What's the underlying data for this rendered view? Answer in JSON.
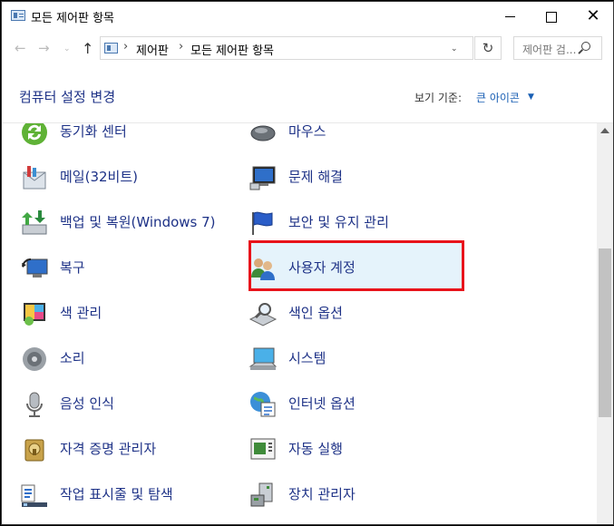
{
  "window": {
    "title": "모든 제어판 항목"
  },
  "titlebar": {
    "min": "",
    "max": "",
    "close": "✕"
  },
  "nav": {
    "back": "←",
    "forward": "→",
    "dropdown": "⌄",
    "up": "↑"
  },
  "address": {
    "sep1": "›",
    "crumb1": "제어판",
    "sep2": "›",
    "crumb2": "모든 제어판 항목",
    "dropdown": "⌄",
    "refresh": "↻"
  },
  "search": {
    "placeholder": "제어판 검..."
  },
  "header": {
    "title": "컴퓨터 설정 변경",
    "view_label": "보기 기준:",
    "view_value": "큰 아이콘",
    "view_caret": "▼"
  },
  "items_left": [
    {
      "label": "동기화 센터",
      "icon": "sync-center-icon"
    },
    {
      "label": "메일(32비트)",
      "icon": "mail-icon"
    },
    {
      "label": "백업 및 복원(Windows 7)",
      "icon": "backup-restore-icon"
    },
    {
      "label": "복구",
      "icon": "recovery-icon"
    },
    {
      "label": "색 관리",
      "icon": "color-management-icon"
    },
    {
      "label": "소리",
      "icon": "sound-icon"
    },
    {
      "label": "음성 인식",
      "icon": "speech-recognition-icon"
    },
    {
      "label": "자격 증명 관리자",
      "icon": "credential-manager-icon"
    },
    {
      "label": "작업 표시줄 및 탐색",
      "icon": "taskbar-navigation-icon"
    }
  ],
  "items_right": [
    {
      "label": "마우스",
      "icon": "mouse-icon"
    },
    {
      "label": "문제 해결",
      "icon": "troubleshooting-icon"
    },
    {
      "label": "보안 및 유지 관리",
      "icon": "security-maintenance-icon"
    },
    {
      "label": "사용자 계정",
      "icon": "user-accounts-icon",
      "selected": true
    },
    {
      "label": "색인 옵션",
      "icon": "indexing-options-icon"
    },
    {
      "label": "시스템",
      "icon": "system-icon"
    },
    {
      "label": "인터넷 옵션",
      "icon": "internet-options-icon"
    },
    {
      "label": "자동 실행",
      "icon": "autoplay-icon"
    },
    {
      "label": "장치 관리자",
      "icon": "device-manager-icon"
    }
  ],
  "colors": {
    "link": "#1e3287",
    "accent": "#1a5fb4",
    "highlight_border": "#e8141b",
    "selection_bg": "#e5f3fb"
  }
}
